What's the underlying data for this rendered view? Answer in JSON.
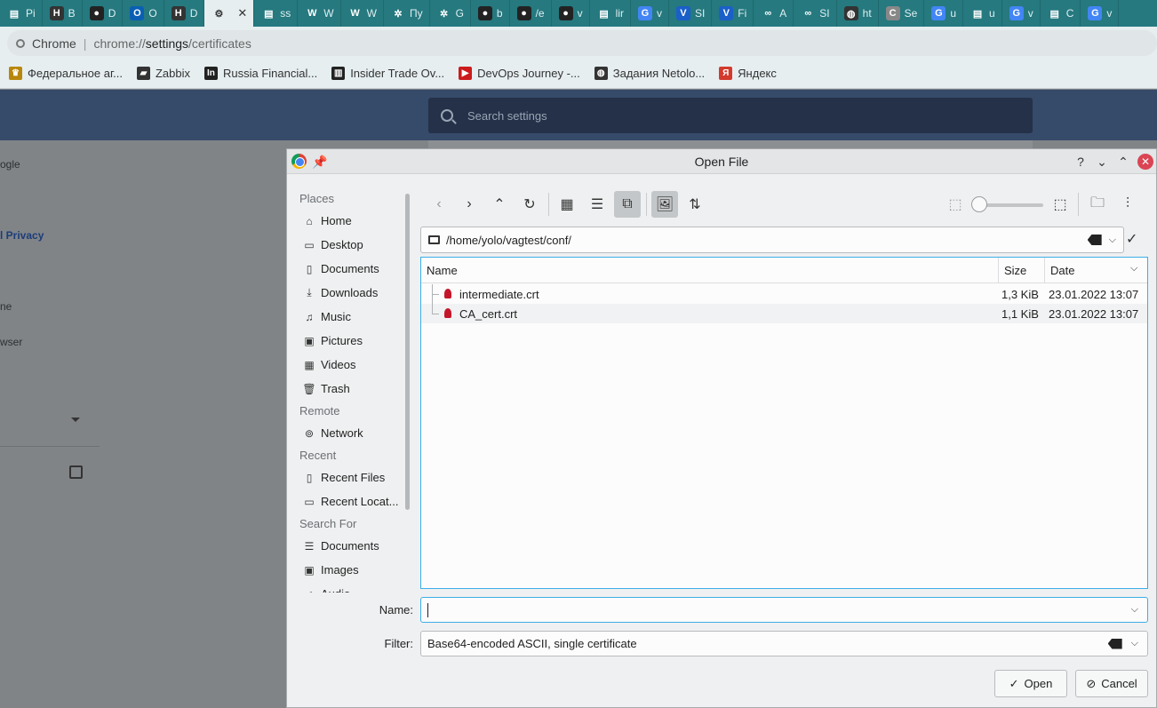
{
  "tabs": [
    {
      "label": "Pi",
      "icon": "page-icon"
    },
    {
      "label": "B",
      "icon": "hashicorp-icon"
    },
    {
      "label": "D",
      "icon": "github-icon"
    },
    {
      "label": "O",
      "icon": "outlook-icon"
    },
    {
      "label": "D",
      "icon": "hashicorp-icon"
    },
    {
      "label": "",
      "icon": "gear-icon",
      "active": true
    },
    {
      "label": "ss",
      "icon": "page-icon"
    },
    {
      "label": "W",
      "icon": "wordpress-icon"
    },
    {
      "label": "W",
      "icon": "wordpress-icon"
    },
    {
      "label": "Пу",
      "icon": "star-icon"
    },
    {
      "label": "G",
      "icon": "star-icon"
    },
    {
      "label": "b",
      "icon": "github-icon"
    },
    {
      "label": "/e",
      "icon": "github-icon"
    },
    {
      "label": "v",
      "icon": "github-icon"
    },
    {
      "label": "lir",
      "icon": "page-icon"
    },
    {
      "label": "v",
      "icon": "google-icon"
    },
    {
      "label": "SI",
      "icon": "v-icon"
    },
    {
      "label": "Fi",
      "icon": "v-icon"
    },
    {
      "label": "A",
      "icon": "link-icon"
    },
    {
      "label": "SI",
      "icon": "link-icon"
    },
    {
      "label": "ht",
      "icon": "globe-icon"
    },
    {
      "label": "Se",
      "icon": "c-icon"
    },
    {
      "label": "u",
      "icon": "google-icon"
    },
    {
      "label": "u",
      "icon": "page-icon"
    },
    {
      "label": "v",
      "icon": "google-icon"
    },
    {
      "label": "C",
      "icon": "page-icon"
    },
    {
      "label": "v",
      "icon": "google-icon"
    }
  ],
  "omnibox": {
    "site": "Chrome",
    "url_scheme": "chrome://",
    "url_host": "settings",
    "url_path": "/certificates"
  },
  "bookmarks": [
    {
      "label": "Федеральное аг...",
      "icon": "emblem-icon",
      "color": "#b8860b"
    },
    {
      "label": "Zabbix",
      "icon": "folder-icon",
      "color": "#333333"
    },
    {
      "label": "Russia Financial...",
      "icon": "investing-icon",
      "color": "#222222"
    },
    {
      "label": "Insider Trade Ov...",
      "icon": "chart-icon",
      "color": "#222222"
    },
    {
      "label": "DevOps Journey -...",
      "icon": "youtube-icon",
      "color": "#cc1b1b"
    },
    {
      "label": "Задания Netolo...",
      "icon": "globe-icon",
      "color": "#333333"
    },
    {
      "label": "Яндекс",
      "icon": "yandex-icon",
      "color": "#d33a2c"
    }
  ],
  "settings": {
    "search_placeholder": "Search settings",
    "sidebar_fragments": [
      "ogle",
      "l Privacy",
      "ne",
      "wser"
    ]
  },
  "dialog": {
    "title": "Open File",
    "places": {
      "places_header": "Places",
      "places_items": [
        {
          "label": "Home",
          "icon": "home-icon"
        },
        {
          "label": "Desktop",
          "icon": "desktop-icon"
        },
        {
          "label": "Documents",
          "icon": "documents-icon"
        },
        {
          "label": "Downloads",
          "icon": "downloads-icon"
        },
        {
          "label": "Music",
          "icon": "music-icon"
        },
        {
          "label": "Pictures",
          "icon": "pictures-icon"
        },
        {
          "label": "Videos",
          "icon": "videos-icon"
        },
        {
          "label": "Trash",
          "icon": "trash-icon"
        }
      ],
      "remote_header": "Remote",
      "remote_items": [
        {
          "label": "Network",
          "icon": "network-icon"
        }
      ],
      "recent_header": "Recent",
      "recent_items": [
        {
          "label": "Recent Files",
          "icon": "recent-files-icon"
        },
        {
          "label": "Recent Locat...",
          "icon": "recent-locations-icon"
        }
      ],
      "search_header": "Search For",
      "search_items": [
        {
          "label": "Documents",
          "icon": "documents-search-icon"
        },
        {
          "label": "Images",
          "icon": "images-icon"
        },
        {
          "label": "Audio",
          "icon": "audio-icon"
        }
      ]
    },
    "path": "/home/yolo/vagtest/conf/",
    "columns": {
      "name": "Name",
      "size": "Size",
      "date": "Date"
    },
    "files": [
      {
        "name": "intermediate.crt",
        "size": "1,3 KiB",
        "date": "23.01.2022 13:07"
      },
      {
        "name": "CA_cert.crt",
        "size": "1,1 KiB",
        "date": "23.01.2022 13:07"
      }
    ],
    "name_label": "Name:",
    "name_value": "",
    "filter_label": "Filter:",
    "filter_value": "Base64-encoded ASCII, single certificate",
    "open_button": "Open",
    "cancel_button": "Cancel",
    "accent_color": "#3daee9"
  }
}
